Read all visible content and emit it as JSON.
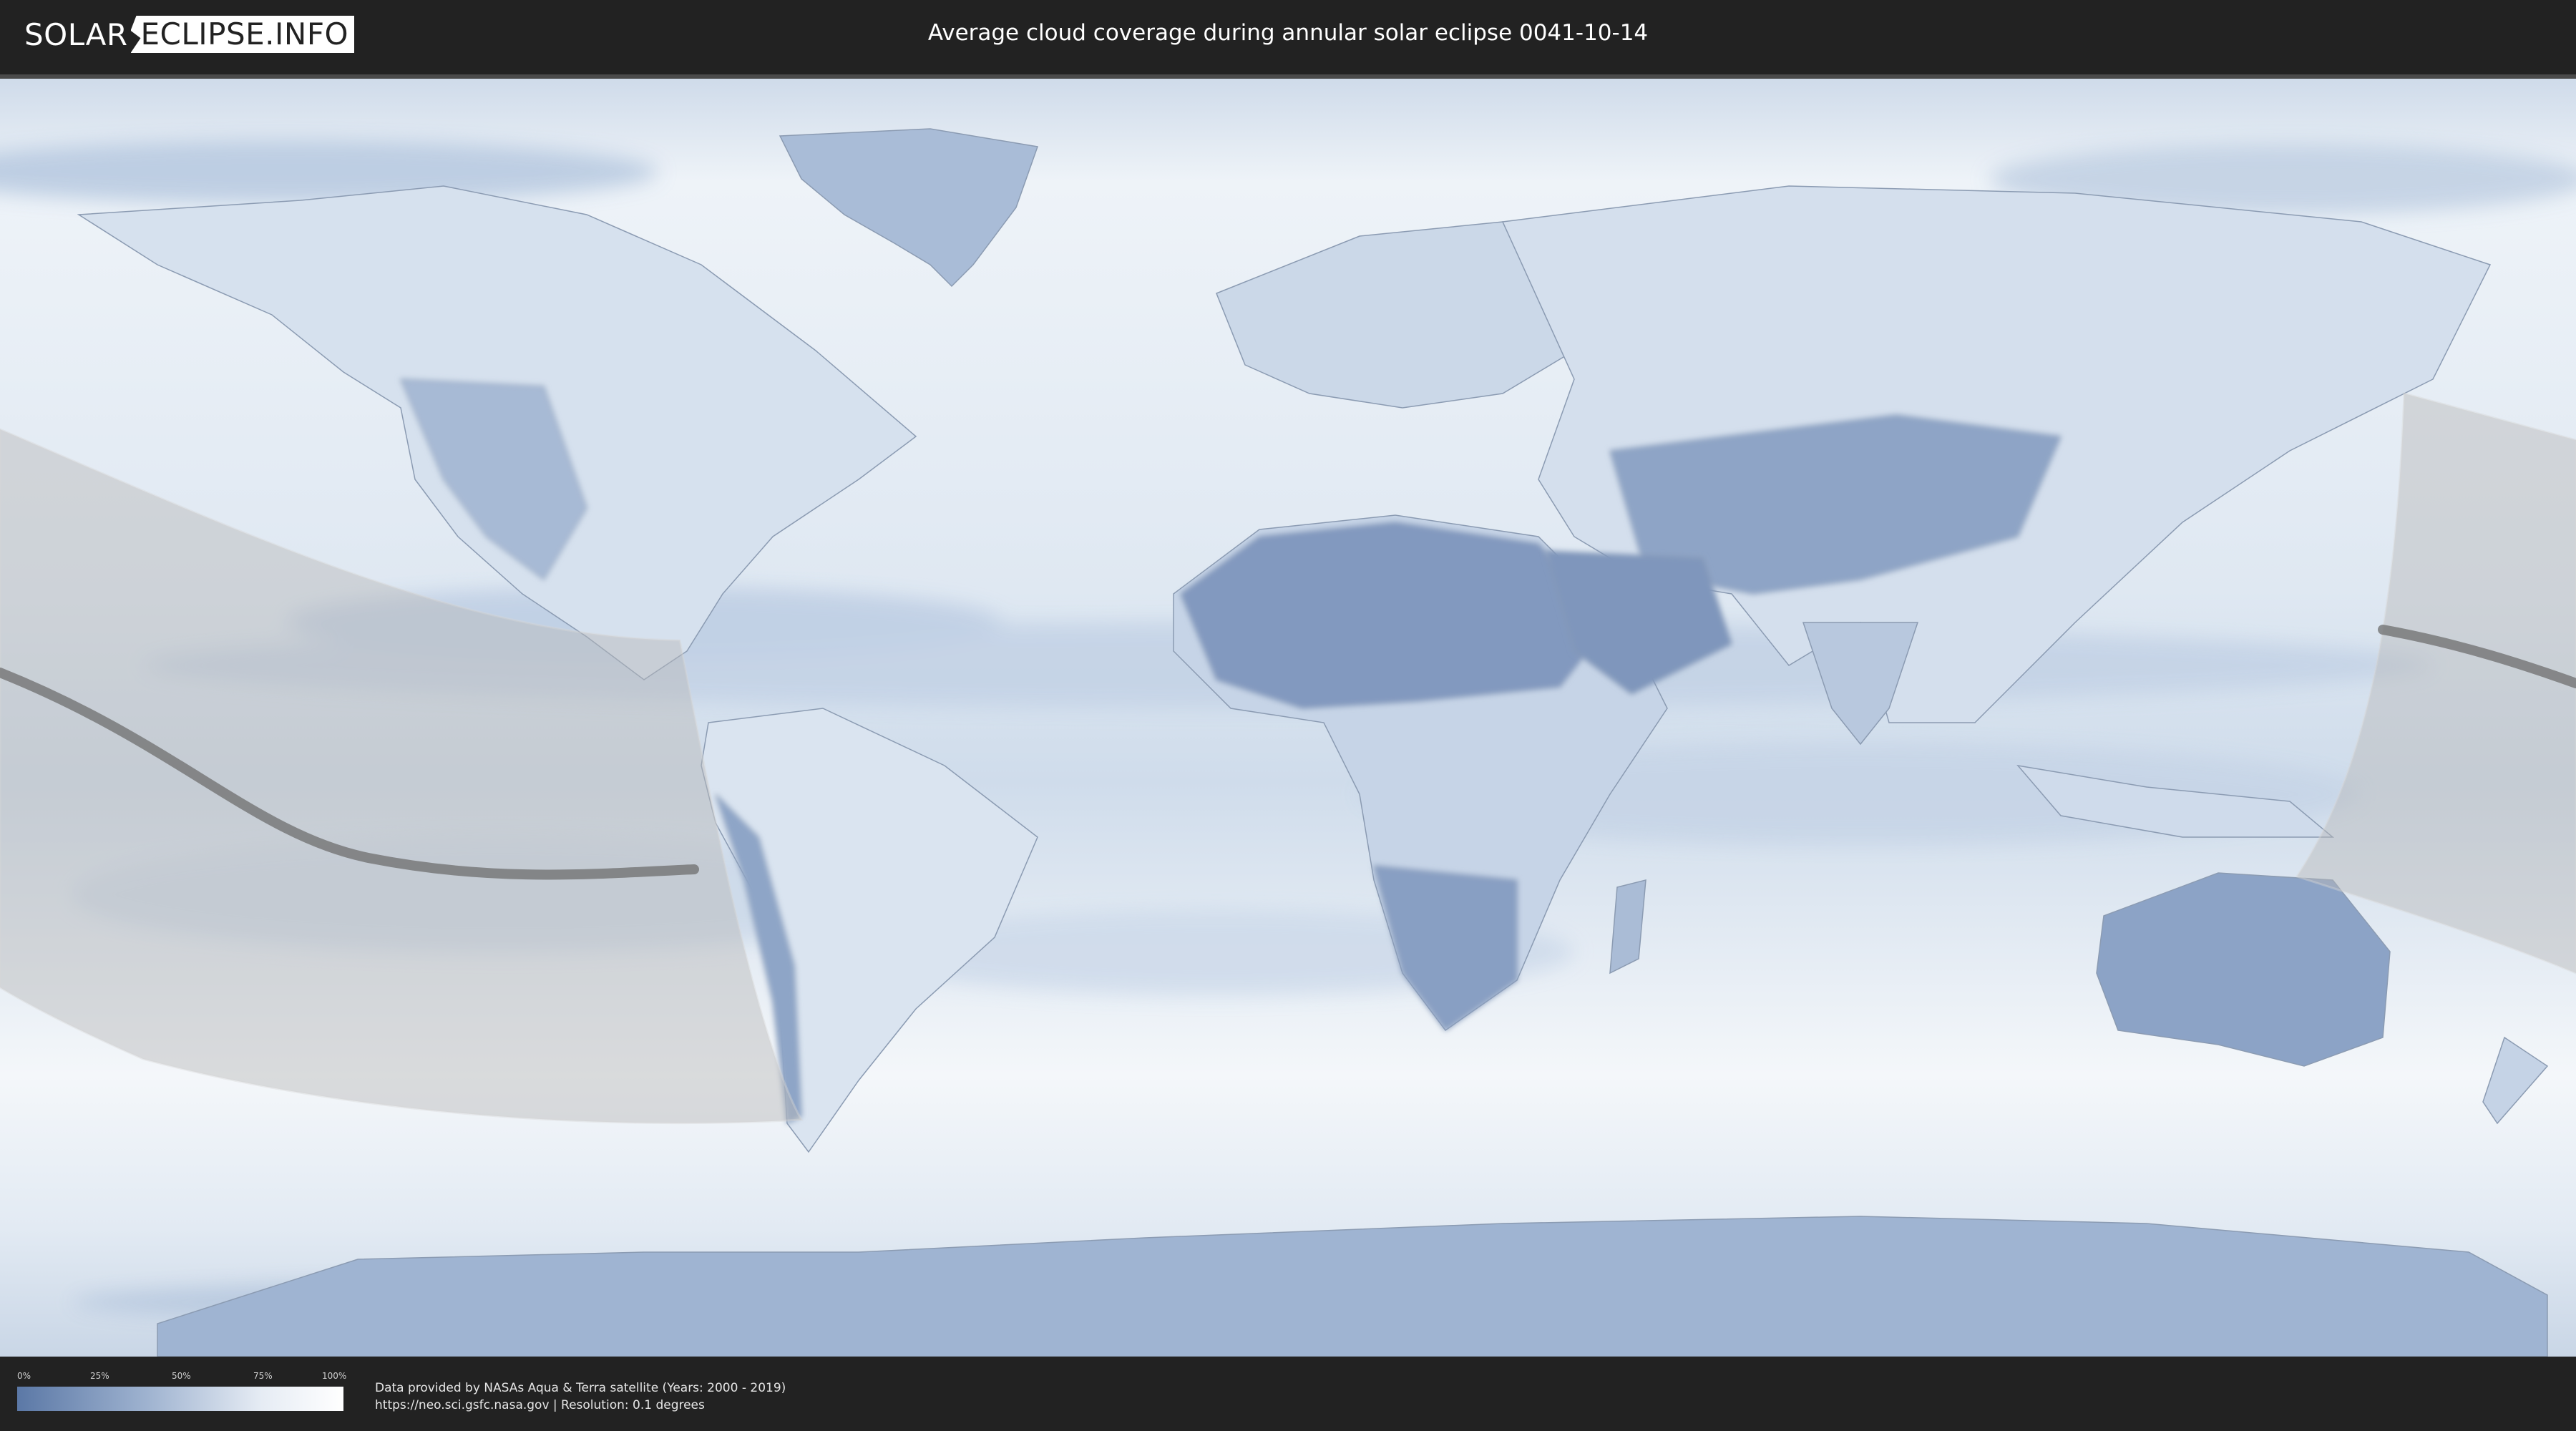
{
  "header": {
    "logo_left": "SOLAR",
    "logo_right": "ECLIPSE.INFO",
    "title": "Average cloud coverage during annular solar eclipse 0041-10-14"
  },
  "legend": {
    "ticks": [
      "0%",
      "25%",
      "50%",
      "75%",
      "100%"
    ],
    "gradient_colors": [
      "#5b78a6",
      "#9fb3d0",
      "#e6ecf4",
      "#ffffff"
    ]
  },
  "credits": {
    "line1": "Data provided by NASAs Aqua & Terra satellite (Years: 2000 - 2019)",
    "line2": "https://neo.sci.gsfc.nasa.gov | Resolution: 0.1 degrees"
  },
  "colors": {
    "background": "#222222",
    "cloud_clear": "#ffffff",
    "cloud_low": "#5b78a6",
    "eclipse_zone": "#c8c8c8",
    "central_line": "#6e6e6e"
  },
  "map": {
    "projection": "equirectangular world map",
    "overlay": "eclipse visibility zone with central path line"
  }
}
